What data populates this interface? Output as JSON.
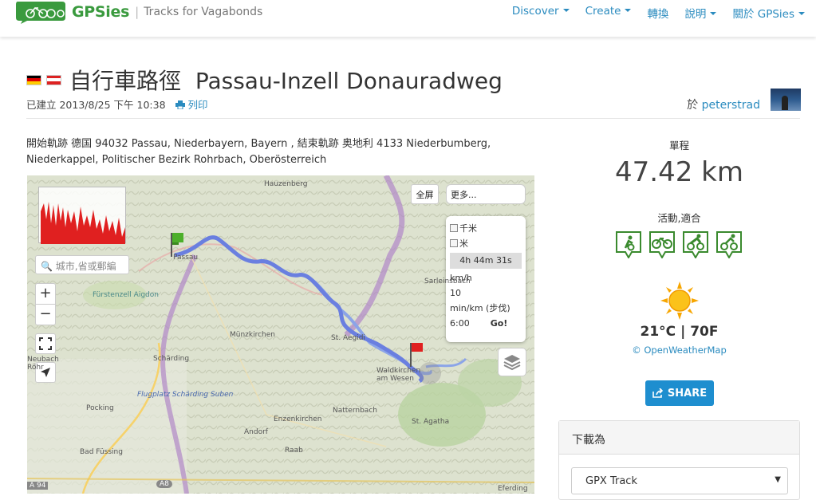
{
  "navbar": {
    "brand": "GPSies",
    "tagline": "Tracks for Vagabonds",
    "items": [
      {
        "label": "Discover",
        "dropdown": true
      },
      {
        "label": "Create",
        "dropdown": true
      },
      {
        "label": "轉換",
        "dropdown": false
      },
      {
        "label": "說明",
        "dropdown": true
      },
      {
        "label": "關於 GPSies",
        "dropdown": true
      }
    ]
  },
  "title": {
    "prefix": "自行車路徑",
    "name": "Passau-Inzell Donauradweg",
    "flags": [
      "germany-flag",
      "austria-flag"
    ]
  },
  "meta": {
    "created": "已建立 2013/8/25 下午 10:38",
    "print": "列印",
    "author_prefix": "於",
    "author": "peterstrad"
  },
  "description": "開始軌跡 德国 94032 Passau, Niederbayern, Bayern , 結束軌跡 奥地利 4133 Niederbumberg, Niederkappel, Politischer Bezirk Rohrbach, Oberösterreich",
  "map": {
    "fullscreen": "全屏",
    "more": "更多...",
    "search_placeholder": "城市,省或郵編",
    "units": {
      "km": "千米",
      "m": "米",
      "duration": "4h 44m 31s",
      "speed_unit": "km/h",
      "speed": "10",
      "pace_unit": "min/km (步伐)",
      "pace": "6:00",
      "go": "Go!"
    },
    "places": [
      "Hauzenberg",
      "Passau",
      "Fürstenzell Aigdon",
      "Münzkirchen",
      "St. Aegidi",
      "Sarleinsbach",
      "Schärding",
      "Waldkirchen am Wesen",
      "Neubach Röhr",
      "Flugplatz Schärding Suben",
      "Pocking",
      "Enzenkirchen",
      "Natternbach",
      "St. Agatha",
      "Andorf",
      "Bad Füssing",
      "Raab",
      "A 94",
      "A8",
      "Eferding"
    ]
  },
  "stats": {
    "distance_label": "單程",
    "distance": "47.42 km",
    "activity_label": "活動,適合",
    "activities": [
      "biking-icon",
      "bicycle-icon",
      "racing-bike-icon",
      "mountain-bike-icon"
    ],
    "temperature": "21°C | 70F",
    "weather_credit": "© OpenWeatherMap",
    "share": "SHARE"
  },
  "download": {
    "header": "下載為",
    "format": "GPX Track"
  },
  "colors": {
    "accent": "#2a8bbf",
    "brand": "#3a9a3e",
    "track": "#6a7fe0",
    "share": "#1e8ecf",
    "activity": "#3a8a2e"
  }
}
